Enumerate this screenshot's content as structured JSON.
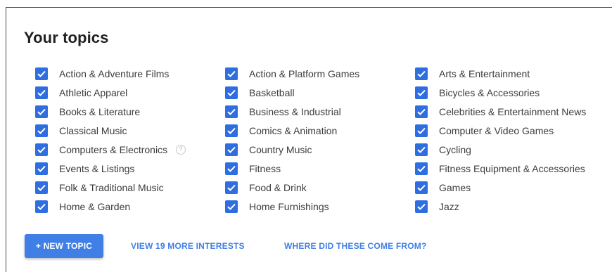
{
  "title": "Your topics",
  "accent_color": "#2f6ee0",
  "columns": [
    {
      "items": [
        {
          "label": "Action & Adventure Films",
          "checked": true
        },
        {
          "label": "Athletic Apparel",
          "checked": true
        },
        {
          "label": "Books & Literature",
          "checked": true
        },
        {
          "label": "Classical Music",
          "checked": true
        },
        {
          "label": "Computers & Electronics",
          "checked": true,
          "help_icon": "?"
        },
        {
          "label": "Events & Listings",
          "checked": true
        },
        {
          "label": "Folk & Traditional Music",
          "checked": true
        },
        {
          "label": "Home & Garden",
          "checked": true
        }
      ]
    },
    {
      "items": [
        {
          "label": "Action & Platform Games",
          "checked": true
        },
        {
          "label": "Basketball",
          "checked": true
        },
        {
          "label": "Business & Industrial",
          "checked": true
        },
        {
          "label": "Comics & Animation",
          "checked": true
        },
        {
          "label": "Country Music",
          "checked": true
        },
        {
          "label": "Fitness",
          "checked": true
        },
        {
          "label": "Food & Drink",
          "checked": true
        },
        {
          "label": "Home Furnishings",
          "checked": true
        }
      ]
    },
    {
      "items": [
        {
          "label": "Arts & Entertainment",
          "checked": true
        },
        {
          "label": "Bicycles & Accessories",
          "checked": true
        },
        {
          "label": "Celebrities & Entertainment News",
          "checked": true
        },
        {
          "label": "Computer & Video Games",
          "checked": true
        },
        {
          "label": "Cycling",
          "checked": true
        },
        {
          "label": "Fitness Equipment & Accessories",
          "checked": true
        },
        {
          "label": "Games",
          "checked": true
        },
        {
          "label": "Jazz",
          "checked": true
        }
      ]
    }
  ],
  "actions": {
    "new_topic": "+ NEW TOPIC",
    "view_more": "VIEW 19 MORE INTERESTS",
    "where_from": "WHERE DID THESE COME FROM?"
  }
}
